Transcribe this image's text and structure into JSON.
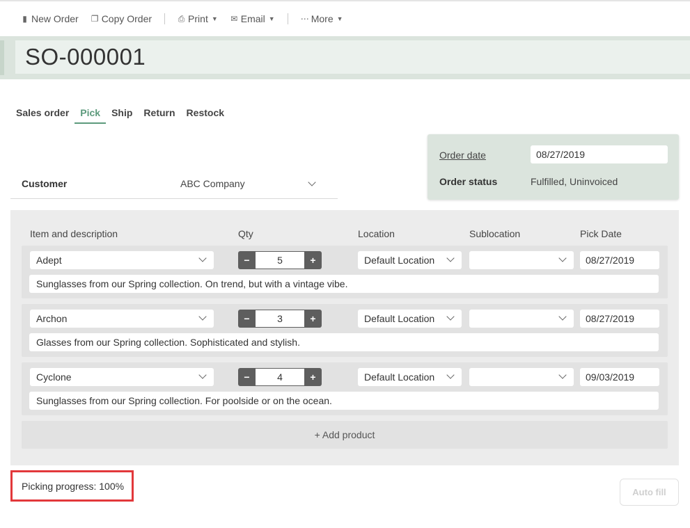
{
  "toolbar": {
    "new_order": "New Order",
    "copy_order": "Copy Order",
    "print": "Print",
    "email": "Email",
    "more": "More"
  },
  "title": "SO-000001",
  "tabs": [
    {
      "label": "Sales order",
      "active": false
    },
    {
      "label": "Pick",
      "active": true
    },
    {
      "label": "Ship",
      "active": false
    },
    {
      "label": "Return",
      "active": false
    },
    {
      "label": "Restock",
      "active": false
    }
  ],
  "customer": {
    "label": "Customer",
    "value": "ABC Company"
  },
  "order_info": {
    "order_date_label": "Order date",
    "order_date": "08/27/2019",
    "order_status_label": "Order status",
    "order_status": "Fulfilled, Uninvoiced"
  },
  "columns": {
    "item": "Item and description",
    "qty": "Qty",
    "location": "Location",
    "sublocation": "Sublocation",
    "pick_date": "Pick Date"
  },
  "items": [
    {
      "name": "Adept",
      "qty": "5",
      "location": "Default Location",
      "sublocation": "",
      "pick_date": "08/27/2019",
      "description": "Sunglasses from our Spring collection. On trend, but with a vintage vibe."
    },
    {
      "name": "Archon",
      "qty": "3",
      "location": "Default Location",
      "sublocation": "",
      "pick_date": "08/27/2019",
      "description": "Glasses from our Spring collection. Sophisticated and stylish."
    },
    {
      "name": "Cyclone",
      "qty": "4",
      "location": "Default Location",
      "sublocation": "",
      "pick_date": "09/03/2019",
      "description": "Sunglasses from our Spring collection. For poolside or on the ocean."
    }
  ],
  "add_product": "+ Add product",
  "picking_progress": "Picking progress: 100%",
  "auto_fill": "Auto fill",
  "colors": {
    "accent": "#5c9a7c",
    "header_band": "#dbe4dd",
    "highlight": "#e2383b"
  }
}
